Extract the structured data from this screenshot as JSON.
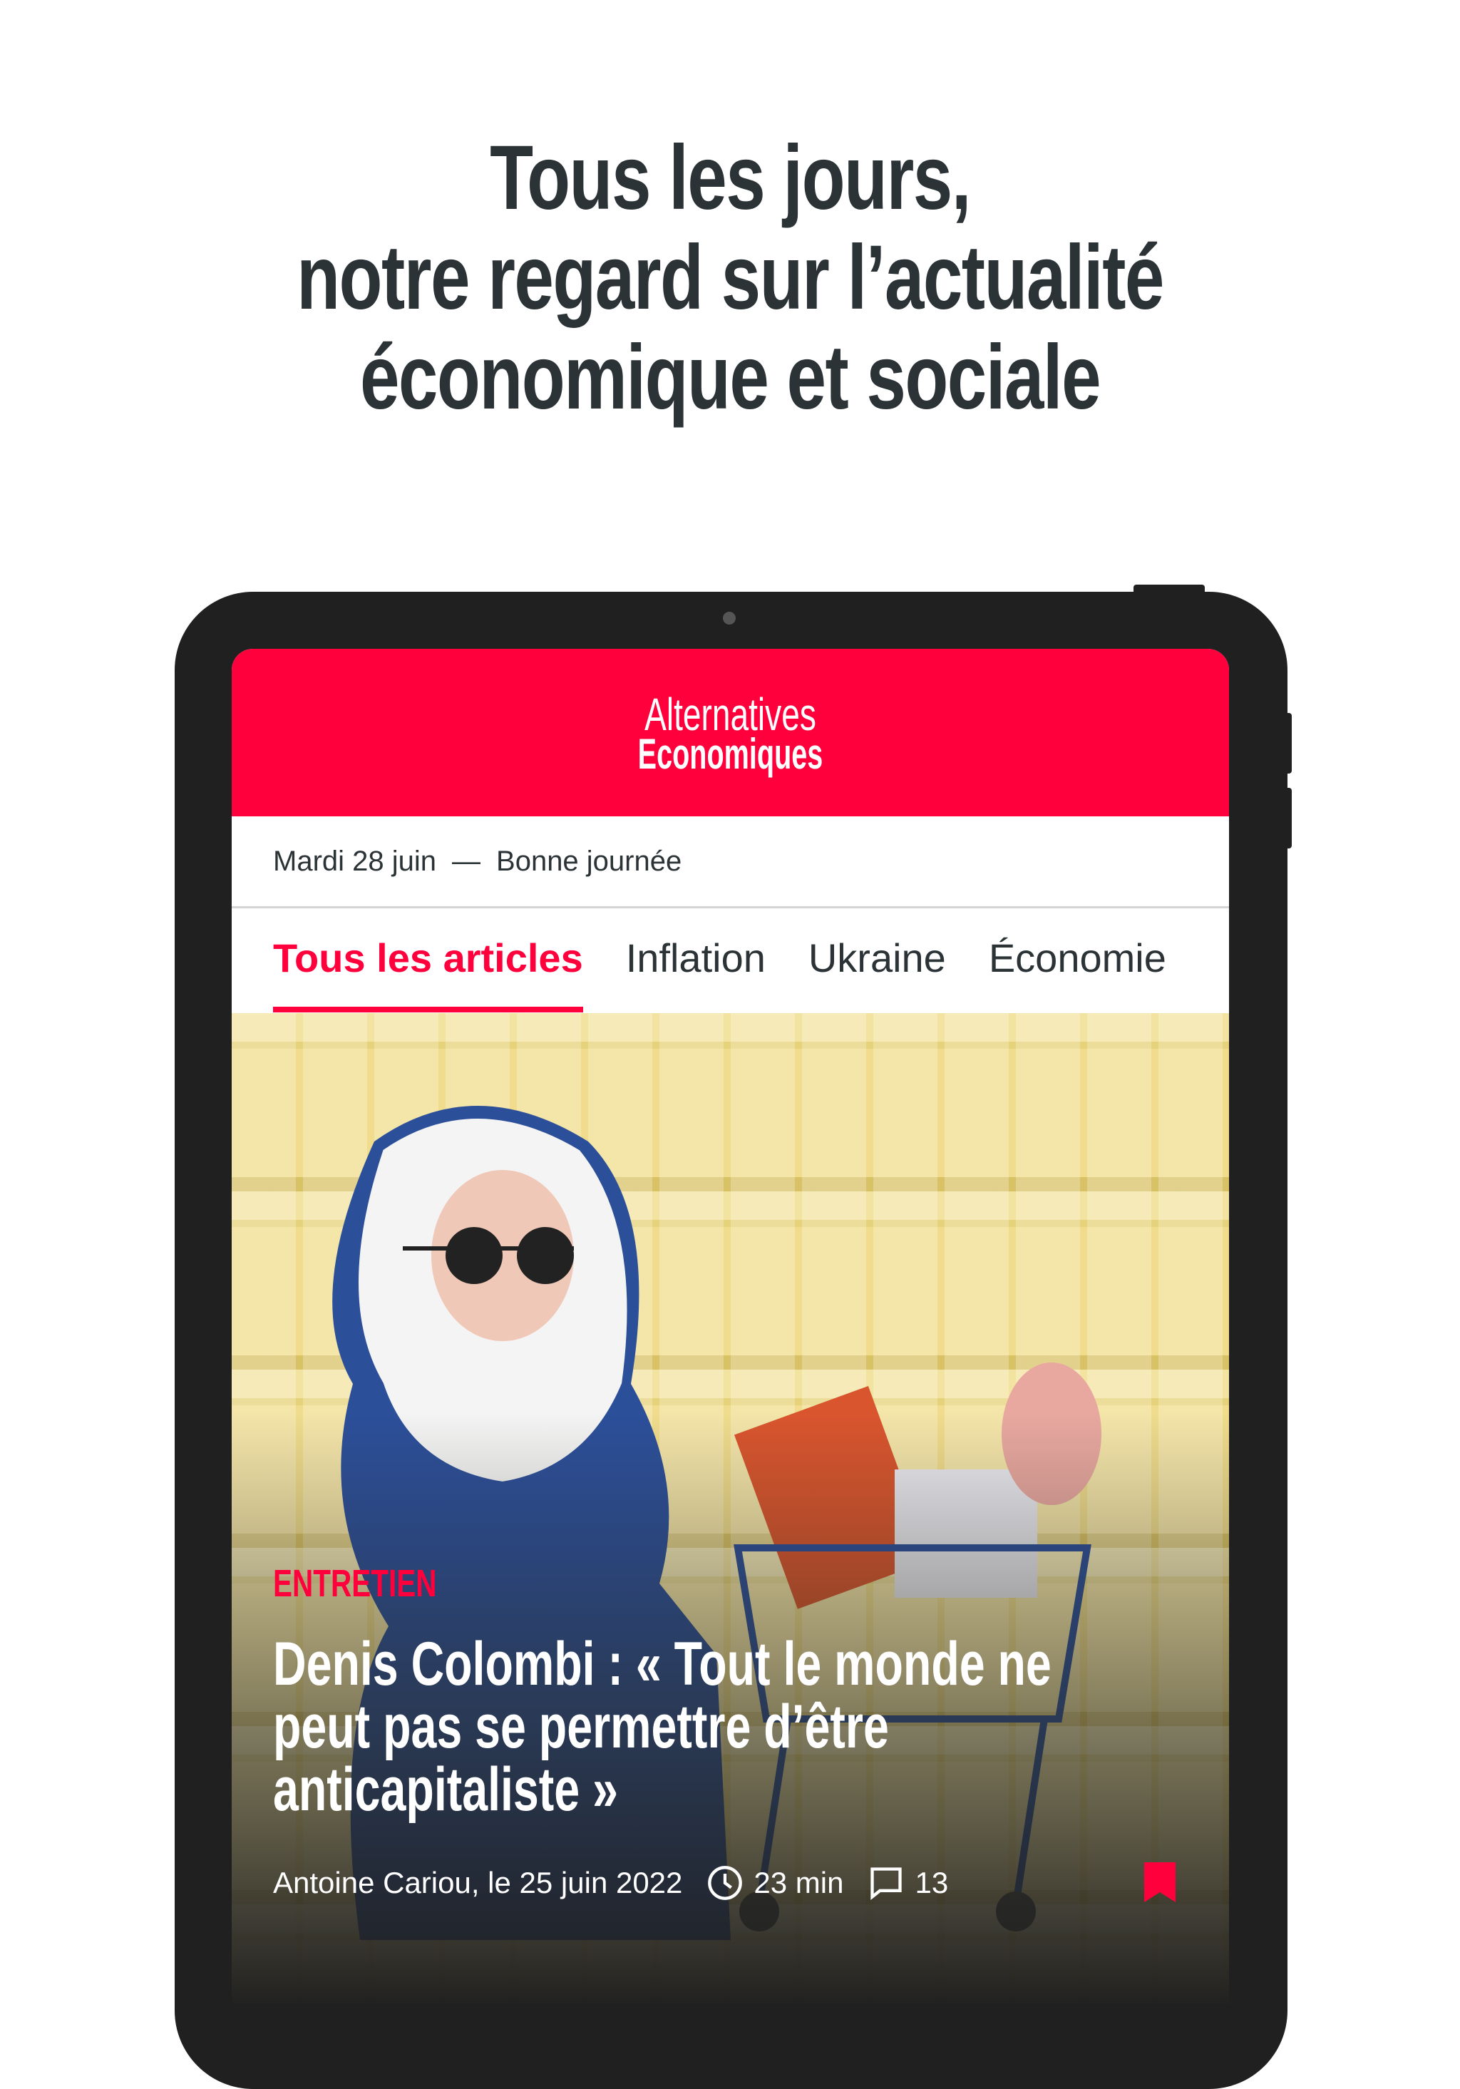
{
  "headline": {
    "lines": [
      "Tous les jours,",
      "notre regard sur l’actualité",
      "économique et sociale"
    ]
  },
  "app": {
    "brand_color": "#ff003c",
    "logo": {
      "line1": "Alternatives",
      "line2": "Economiques"
    },
    "date_bar": {
      "date": "Mardi 28 juin",
      "separator": "—",
      "greeting": "Bonne journée"
    },
    "tabs": [
      {
        "label": "Tous les articles",
        "active": true
      },
      {
        "label": "Inflation",
        "active": false
      },
      {
        "label": "Ukraine",
        "active": false
      },
      {
        "label": "Économie",
        "active": false
      }
    ],
    "featured": {
      "kicker": "ENTRETIEN",
      "title": "Denis Colombi : « Tout le monde ne peut pas se permettre d’être anticapitaliste »",
      "byline": "Antoine Cariou, le 25 juin 2022",
      "read_time": "23 min",
      "comments": "13",
      "icons": [
        "clock-icon",
        "comment-icon",
        "bookmark-icon"
      ]
    }
  }
}
